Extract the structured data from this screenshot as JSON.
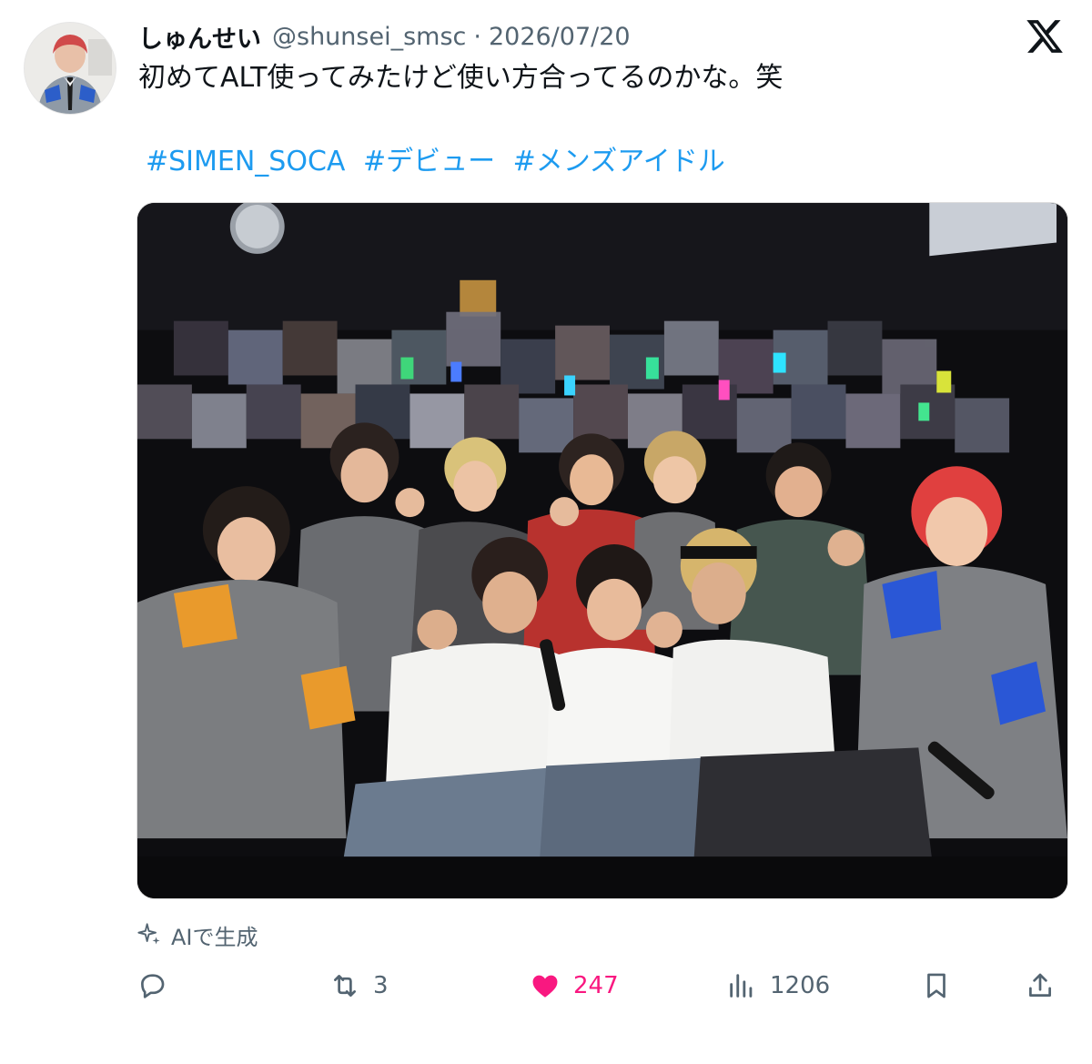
{
  "tweet": {
    "display_name": "しゅんせい",
    "handle": "@shunsei_smsc",
    "separator": "·",
    "date": "2026/07/20",
    "text": "初めてALT使ってみたけど使い方合ってるのかな。笑",
    "hashtags": [
      "#SIMEN_SOCA",
      "#デビュー",
      "#メンズアイドル"
    ]
  },
  "ai_label": "AIで生成",
  "actions": {
    "reply_count": "",
    "retweet_count": "3",
    "like_count": "247",
    "view_count": "1206"
  },
  "icons": {
    "logo": "x-logo-icon",
    "ai": "sparkle-icon",
    "reply": "reply-icon",
    "retweet": "retweet-icon",
    "like": "heart-icon",
    "views": "views-icon",
    "bookmark": "bookmark-icon",
    "share": "share-icon"
  },
  "colors": {
    "hashtag": "#1d9bf0",
    "like": "#f91880",
    "muted": "#536471",
    "text": "#0f1419"
  }
}
